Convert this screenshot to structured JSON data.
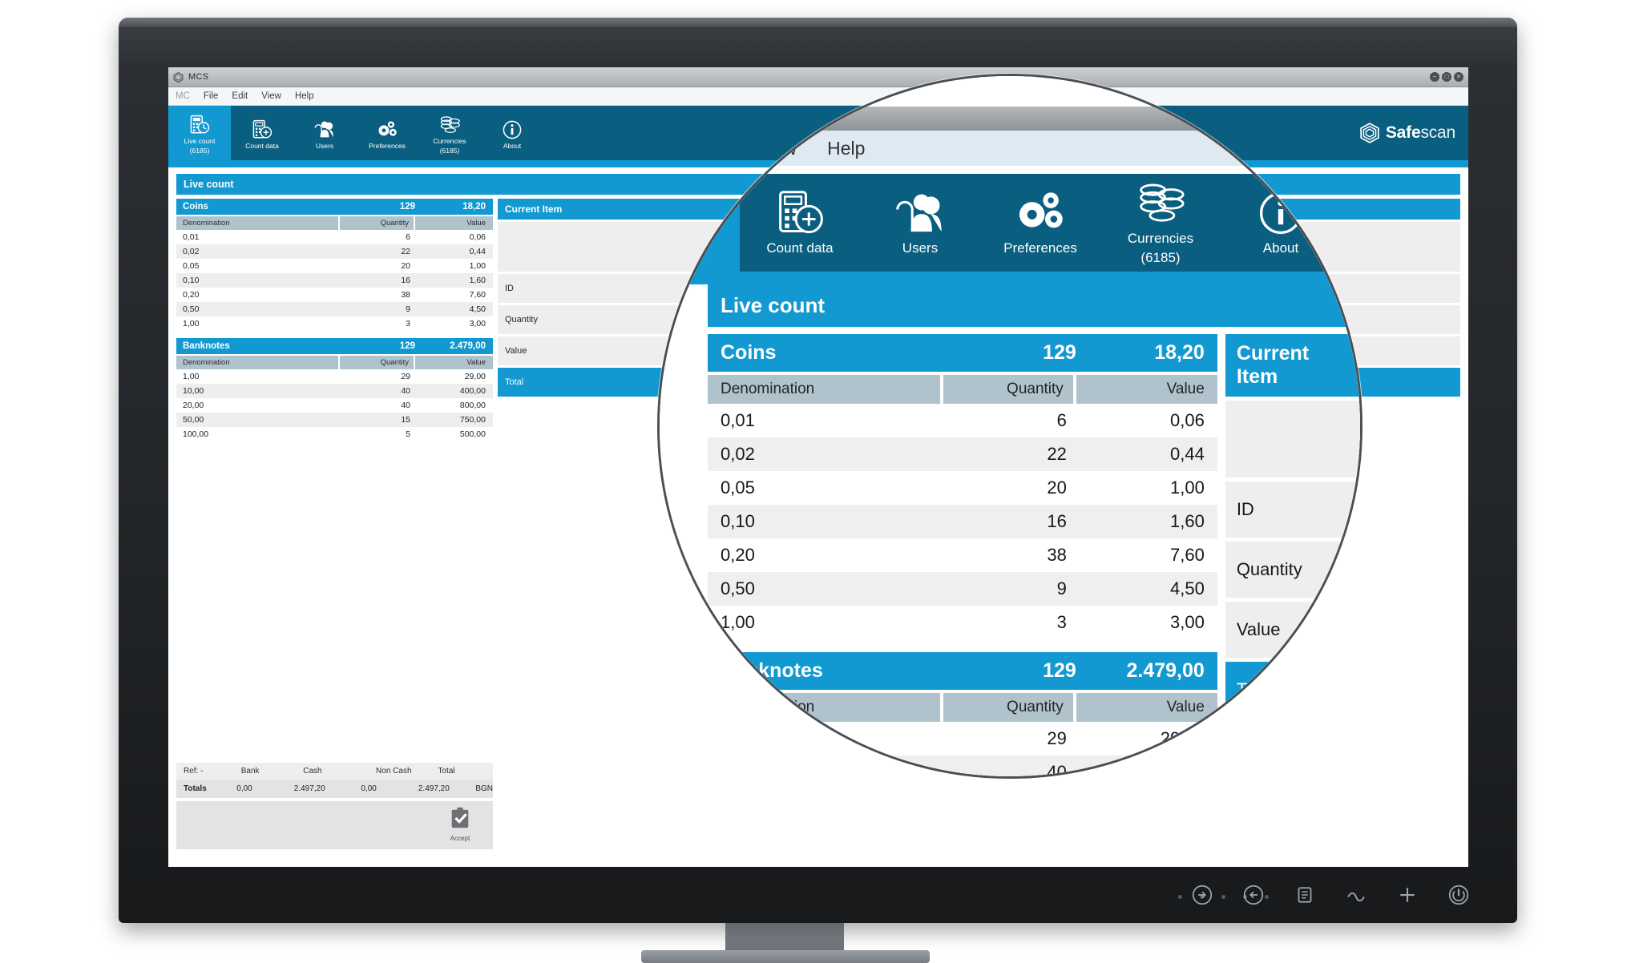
{
  "window": {
    "title": "MCS",
    "logo_icon": "safescan-hex-icon",
    "buttons": [
      {
        "name": "minimize",
        "glyph": "–"
      },
      {
        "name": "maximize",
        "glyph": "□"
      },
      {
        "name": "close",
        "glyph": "×"
      }
    ]
  },
  "menubar": {
    "items": [
      "MC",
      "File",
      "Edit",
      "View",
      "Help"
    ]
  },
  "magnified_menubar": {
    "items": [
      "Edit",
      "View",
      "Help"
    ]
  },
  "ribbon": {
    "tabs": [
      {
        "label": "Live count",
        "sub": "(6185)",
        "icon": "live-count-icon",
        "active": true
      },
      {
        "label": "Count data",
        "sub": "",
        "icon": "count-data-icon",
        "active": false
      },
      {
        "label": "Users",
        "sub": "",
        "icon": "users-icon",
        "active": false
      },
      {
        "label": "Preferences",
        "sub": "",
        "icon": "preferences-gears-icon",
        "active": false
      },
      {
        "label": "Currencies",
        "sub": "(6185)",
        "icon": "coins-stack-icon",
        "active": false
      },
      {
        "label": "About",
        "sub": "",
        "icon": "info-icon",
        "active": false
      }
    ],
    "brand_bold": "Safe",
    "brand_light": "scan",
    "brand_icon": "safescan-hex-icon"
  },
  "section": {
    "title": "Live count"
  },
  "coins": {
    "title": "Coins",
    "total_quantity": "129",
    "total_value": "18,20",
    "columns": [
      "Denomination",
      "Quantity",
      "Value"
    ],
    "rows": [
      {
        "denomination": "0,01",
        "quantity": "6",
        "value": "0,06"
      },
      {
        "denomination": "0,02",
        "quantity": "22",
        "value": "0,44"
      },
      {
        "denomination": "0,05",
        "quantity": "20",
        "value": "1,00"
      },
      {
        "denomination": "0,10",
        "quantity": "16",
        "value": "1,60"
      },
      {
        "denomination": "0,20",
        "quantity": "38",
        "value": "7,60"
      },
      {
        "denomination": "0,50",
        "quantity": "9",
        "value": "4,50"
      },
      {
        "denomination": "1,00",
        "quantity": "3",
        "value": "3,00"
      }
    ]
  },
  "banknotes": {
    "title": "Banknotes",
    "total_quantity": "129",
    "total_value": "2.479,00",
    "columns": [
      "Denomination",
      "Quantity",
      "Value"
    ],
    "rows": [
      {
        "denomination": "1,00",
        "quantity": "29",
        "value": "29,00"
      },
      {
        "denomination": "10,00",
        "quantity": "40",
        "value": "400,00"
      },
      {
        "denomination": "20,00",
        "quantity": "40",
        "value": "800,00"
      },
      {
        "denomination": "50,00",
        "quantity": "15",
        "value": "750,00"
      },
      {
        "denomination": "100,00",
        "quantity": "5",
        "value": "500,00"
      }
    ]
  },
  "current_item": {
    "title": "Current Item",
    "fields": [
      {
        "label": "",
        "value": ""
      },
      {
        "label": "ID",
        "value": ""
      },
      {
        "label": "Quantity",
        "value": ""
      },
      {
        "label": "Value",
        "value": ""
      },
      {
        "label": "Total",
        "value": ""
      }
    ]
  },
  "totals": {
    "ref_label": "Ref: -",
    "columns": [
      "Bank",
      "Cash",
      "Non Cash",
      "Total"
    ],
    "row_label": "Totals",
    "values": [
      "0,00",
      "2.497,20",
      "0,00",
      "2.497,20"
    ],
    "currency": "BGN"
  },
  "accept": {
    "label": "Accept",
    "icon": "clipboard-check-icon"
  },
  "monitor": {
    "bezel_buttons": [
      "power-menu-icon",
      "input-icon",
      "display-icon",
      "brightness-icon",
      "plus-icon",
      "power-icon"
    ]
  },
  "colors": {
    "accent": "#1399d1",
    "ribbon": "#0a5e80",
    "col_header": "#b0c2cb",
    "row_alt": "#eeeeee"
  }
}
